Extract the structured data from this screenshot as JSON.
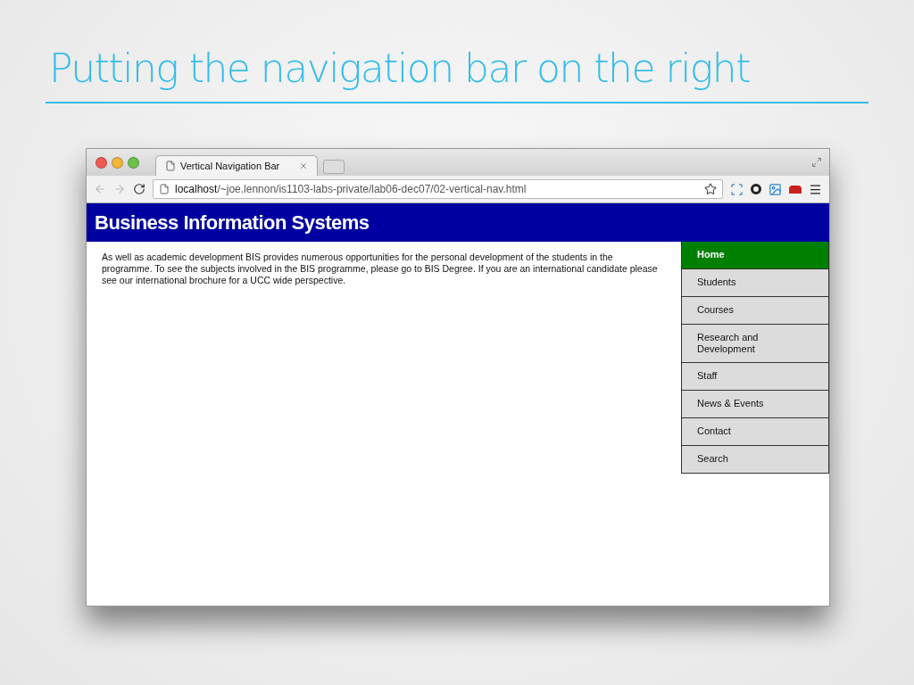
{
  "slide": {
    "title": "Putting the navigation bar on the right"
  },
  "browser": {
    "tab": {
      "title": "Vertical Navigation Bar"
    },
    "url": "**localhost**/~joe.lennon/is1103-labs-private/lab06-dec07/02-vertical-nav.html"
  },
  "page": {
    "header": "Business Information Systems",
    "paragraph": "As well as academic development BIS provides numerous opportunities for the personal development of the students in the programme. To see the subjects involved in the BIS programme, please go to BIS Degree. If you are an international candidate please see our international brochure for a UCC wide perspective.",
    "nav_items": [
      {
        "label": "Home",
        "selected": true
      },
      {
        "label": "Students",
        "selected": false
      },
      {
        "label": "Courses",
        "selected": false
      },
      {
        "label": "Research and Development",
        "selected": false
      },
      {
        "label": "Staff",
        "selected": false
      },
      {
        "label": "News & Events",
        "selected": false
      },
      {
        "label": "Contact",
        "selected": false
      },
      {
        "label": "Search",
        "selected": false
      }
    ]
  }
}
